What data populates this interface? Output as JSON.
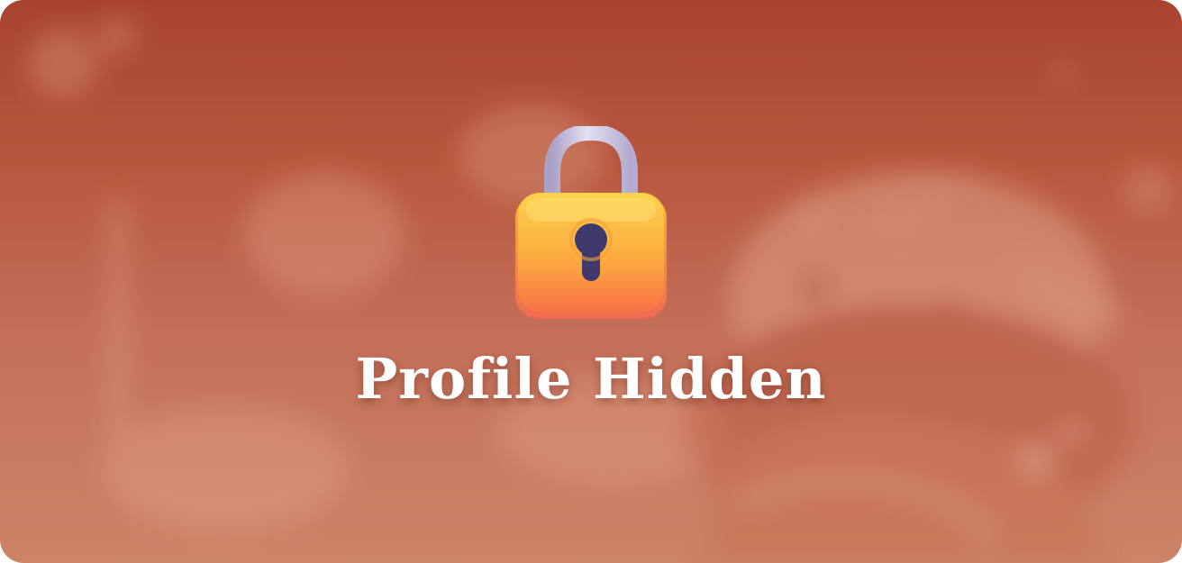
{
  "profile_hidden": {
    "title": "Profile Hidden",
    "icon": "lock-icon"
  },
  "colors": {
    "background_top": "#a8432f",
    "background_bottom": "#cc8466",
    "lock_body_top": "#fcd34d",
    "lock_body_bottom": "#f97346",
    "keyhole": "#3f3a6b",
    "shackle": "#c9c3de",
    "title_text": "#ffffff"
  }
}
